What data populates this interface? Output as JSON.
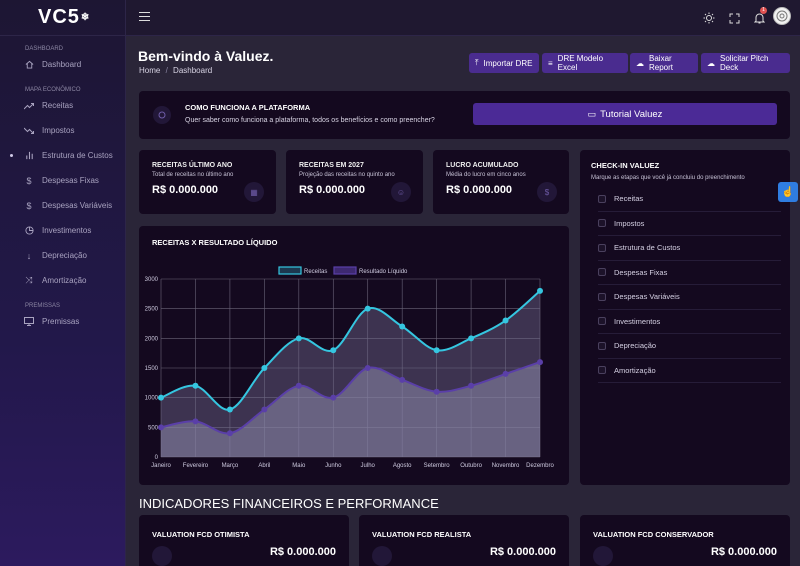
{
  "brand": {
    "name": "VC5",
    "mark": "❄"
  },
  "sidebar": {
    "sections": [
      {
        "title": "DASHBOARD",
        "items": [
          {
            "label": "Dashboard",
            "icon": "home-icon"
          }
        ]
      },
      {
        "title": "MAPA ECONÔMICO",
        "items": [
          {
            "label": "Receitas",
            "icon": "trend-up-icon"
          },
          {
            "label": "Impostos",
            "icon": "trend-down-icon"
          },
          {
            "label": "Estrutura de Custos",
            "icon": "bar-chart-icon"
          },
          {
            "label": "Despesas Fixas",
            "icon": "dollar-icon"
          },
          {
            "label": "Despesas Variáveis",
            "icon": "dollar-icon"
          },
          {
            "label": "Investimentos",
            "icon": "pie-icon"
          },
          {
            "label": "Depreciação",
            "icon": "arrow-down-icon"
          },
          {
            "label": "Amortização",
            "icon": "shuffle-icon"
          }
        ]
      },
      {
        "title": "PREMISSAS",
        "items": [
          {
            "label": "Premissas",
            "icon": "monitor-icon"
          }
        ]
      }
    ]
  },
  "topbar": {
    "notification_count": "1"
  },
  "header": {
    "title": "Bem-vindo à Valuez.",
    "breadcrumb_home": "Home",
    "breadcrumb_sep": "/",
    "breadcrumb_current": "Dashboard",
    "buttons": [
      {
        "label": "Importar DRE",
        "icon": "upload-icon"
      },
      {
        "label": "DRE Modelo Excel",
        "icon": "database-icon"
      },
      {
        "label": "Baixar Report",
        "icon": "cloud-download-icon"
      },
      {
        "label": "Solicitar Pitch Deck",
        "icon": "cloud-upload-icon"
      }
    ]
  },
  "howto": {
    "title": "COMO FUNCIONA A PLATAFORMA",
    "subtitle": "Quer saber como funciona a plataforma, todos os benefícios e como preencher?",
    "button_label": "Tutorial Valuez"
  },
  "kpis": [
    {
      "title": "RECEITAS ÚLTIMO ANO",
      "subtitle": "Total de receitas no último ano",
      "value": "R$ 0.000.000"
    },
    {
      "title": "RECEITAS EM 2027",
      "subtitle": "Projeção das receitas no quinto ano",
      "value": "R$ 0.000.000"
    },
    {
      "title": "LUCRO ACUMULADO",
      "subtitle": "Média do lucro em cinco anos",
      "value": "R$ 0.000.000"
    }
  ],
  "checkin": {
    "title": "CHECK-IN VALUEZ",
    "subtitle": "Marque as etapas que você já concluiu do preenchimento",
    "items": [
      "Receitas",
      "Impostos",
      "Estrutura de Custos",
      "Despesas Fixas",
      "Despesas Variáveis",
      "Investimentos",
      "Depreciação",
      "Amortização"
    ]
  },
  "chart_card_title": "RECEITAS X RESULTADO LÍQUIDO",
  "chart_data": {
    "type": "area",
    "categories": [
      "Janeiro",
      "Fevereiro",
      "Março",
      "Abril",
      "Maio",
      "Junho",
      "Julho",
      "Agosto",
      "Setembro",
      "Outubro",
      "Novembro",
      "Dezembro"
    ],
    "series": [
      {
        "name": "Receitas",
        "values": [
          1000,
          1200,
          800,
          1500,
          2000,
          1800,
          2500,
          2200,
          1800,
          2000,
          2300,
          2800
        ],
        "color": "#35c6e0"
      },
      {
        "name": "Resultado Líquido",
        "values": [
          500,
          600,
          400,
          800,
          1200,
          1000,
          1500,
          1300,
          1100,
          1200,
          1400,
          1600
        ],
        "color": "#5a3fa8"
      }
    ],
    "ylim": [
      0,
      3000
    ],
    "yticks": [
      "0",
      "500",
      "1000",
      "1500",
      "2000",
      "2500",
      "3000"
    ],
    "grid": true,
    "legend": "top-center"
  },
  "indicators": {
    "title": "INDICADORES FINANCEIROS E PERFORMANCE",
    "cards": [
      {
        "title": "VALUATION FCD OTIMISTA",
        "value": "R$ 0.000.000"
      },
      {
        "title": "VALUATION FCD REALISTA",
        "value": "R$ 0.000.000"
      },
      {
        "title": "VALUATION FCD CONSERVADOR",
        "value": "R$ 0.000.000"
      }
    ]
  },
  "colors": {
    "accent": "#4a2c8f",
    "tutorial": "#4b2a96",
    "cyan": "#35c6e0",
    "page_bg": "#2a2538",
    "card_bg": "#14091f"
  }
}
